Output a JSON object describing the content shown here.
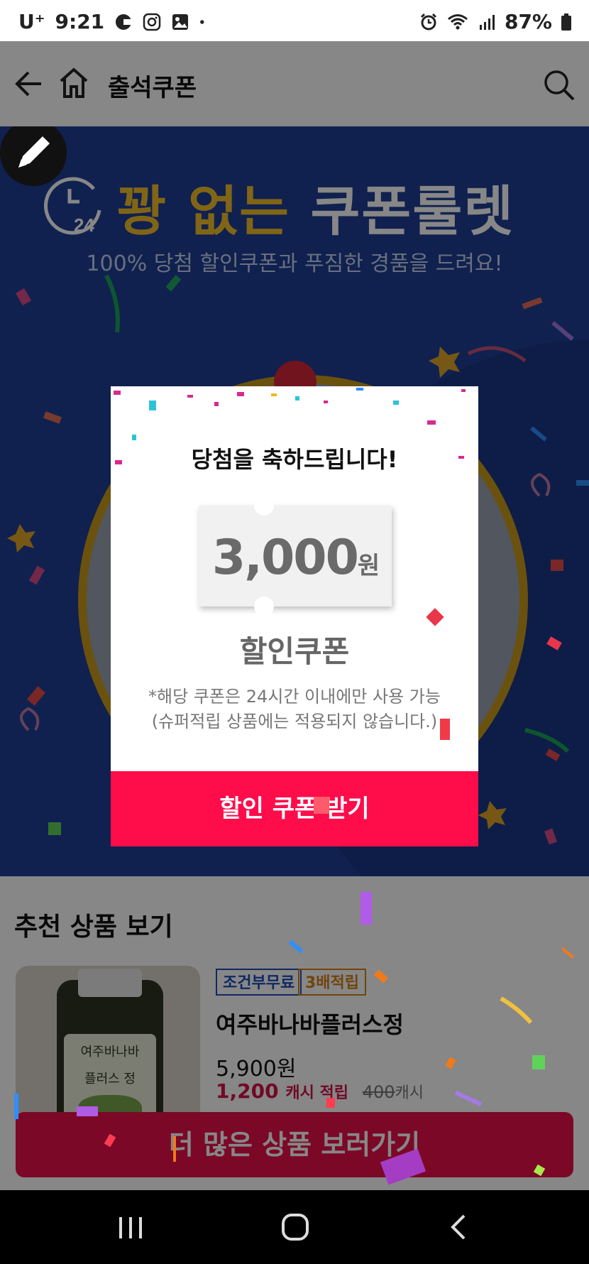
{
  "status_bar": {
    "carrier": "U⁺",
    "time": "9:21",
    "battery": "87%",
    "icons": [
      "tmap-icon",
      "instagram-icon",
      "gallery-icon",
      "dot-icon",
      "alarm-icon",
      "wifi-icon",
      "signal-icon",
      "battery-icon"
    ]
  },
  "header": {
    "title": "출석쿠폰",
    "icons": [
      "back-arrow-icon",
      "home-icon",
      "search-icon"
    ]
  },
  "banner": {
    "headline_gold": "꽝 없는",
    "headline_white": "쿠폰룰렛",
    "subtitle": "100% 당첨 할인쿠폰과 푸짐한 경품을 드려요!",
    "clock_label": "24",
    "colors": {
      "background": "#1f3f96",
      "gold": "#f3bf2a",
      "ring": "#c99a1c"
    }
  },
  "modal": {
    "title": "당첨을 축하드립니다!",
    "amount": "3,000",
    "unit": "원",
    "coupon_type": "할인쿠폰",
    "note_line1": "*해당 쿠폰은 24시간 이내에만 사용 가능",
    "note_line2": "(슈퍼적립 상품에는 적용되지 않습니다.)",
    "cta": "할인 쿠폰 받기",
    "cta_color": "#ff0c4b"
  },
  "recommend": {
    "heading": "추천 상품 보기",
    "product": {
      "badge_free_shipping": "조건부무료",
      "badge_reward": "3배적립",
      "name": "여주바나바플러스정",
      "price": "5,900원",
      "cash_amount": "1,200",
      "cash_label": "캐시 적립",
      "old_cash_amount": "400",
      "old_cash_label": "캐시",
      "image_text_line1": "여주바나바",
      "image_text_line2": "플러스 정"
    },
    "more_button": "더 많은 상품 보러가기"
  },
  "nav_bar": {
    "icons": [
      "recents-icon",
      "home-nav-icon",
      "back-nav-icon"
    ]
  }
}
